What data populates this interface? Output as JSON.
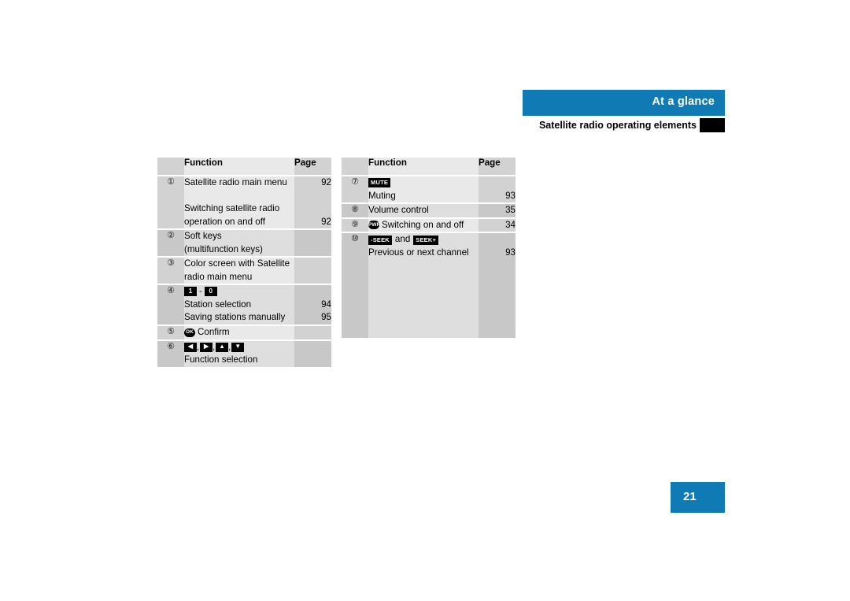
{
  "header": {
    "banner_title": "At a glance",
    "subtitle": "Satellite radio operating elements",
    "banner_color": "#0f7ab4",
    "marker_icon": "black-square-marker"
  },
  "page_footer": {
    "page_number": "21",
    "box_color": "#0f7ab4"
  },
  "tables": {
    "left": {
      "headers": {
        "number": "",
        "function": "Function",
        "page": "Page"
      },
      "rows": [
        {
          "number": "①",
          "lines": [
            {
              "text": "Satellite radio main menu",
              "page": "92"
            },
            {
              "text": "",
              "page": ""
            },
            {
              "text": "Switching satellite radio",
              "page": ""
            },
            {
              "text": "operation on and off",
              "page": "92"
            }
          ]
        },
        {
          "number": "②",
          "lines": [
            {
              "text": "Soft keys",
              "page": ""
            },
            {
              "text": "(multifunction keys)",
              "page": ""
            }
          ]
        },
        {
          "number": "③",
          "lines": [
            {
              "text": "Color screen with Satellite",
              "page": ""
            },
            {
              "text": "radio main menu",
              "page": ""
            }
          ]
        },
        {
          "number": "④",
          "keys": {
            "from": "1",
            "sep": "-",
            "to": "0"
          },
          "lines": [
            {
              "text": "Station selection",
              "page": "94"
            },
            {
              "text": "Saving stations manually",
              "page": "95"
            }
          ]
        },
        {
          "number": "⑤",
          "badge": "OK",
          "lines": [
            {
              "text": "Confirm",
              "page": ""
            }
          ]
        },
        {
          "number": "⑥",
          "arrows": [
            "◀",
            "▶",
            "▲",
            "▼"
          ],
          "lines": [
            {
              "text": "Function selection",
              "page": ""
            }
          ]
        }
      ]
    },
    "right": {
      "headers": {
        "number": "",
        "function": "Function",
        "page": "Page"
      },
      "rows": [
        {
          "number": "⑦",
          "badge_word": "MUTE",
          "lines": [
            {
              "text": "Muting",
              "page": "93"
            }
          ]
        },
        {
          "number": "⑧",
          "lines": [
            {
              "text": "Volume control",
              "page": "35"
            }
          ]
        },
        {
          "number": "⑨",
          "badge": "PWR",
          "lines": [
            {
              "text": "Switching on and off",
              "page": "34"
            }
          ]
        },
        {
          "number": "⑩",
          "seek": {
            "back": "-SEEK",
            "conj": "and",
            "fwd": "SEEK+"
          },
          "lines": [
            {
              "text": "Previous or next channel",
              "page": "93"
            }
          ]
        }
      ]
    }
  }
}
